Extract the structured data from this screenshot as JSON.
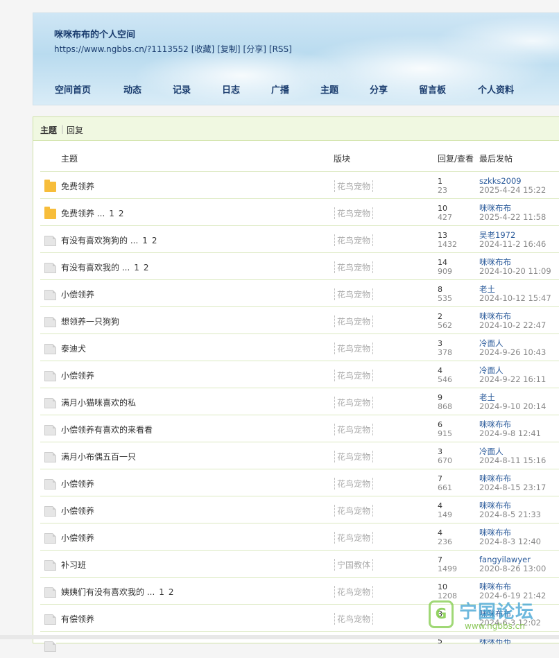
{
  "header": {
    "title": "咪咪布布的个人空间",
    "url": "https://www.ngbbs.cn/?1113552",
    "actions": [
      "[收藏]",
      "[复制]",
      "[分享]",
      "[RSS]"
    ],
    "nav": [
      "空间首页",
      "动态",
      "记录",
      "日志",
      "广播",
      "主题",
      "分享",
      "留言板",
      "个人资料"
    ]
  },
  "tabs": {
    "topic": "主题",
    "sep": "|",
    "reply": "回复"
  },
  "columns": {
    "topic": "主题",
    "forum": "版块",
    "stats": "回复/查看",
    "last": "最后发帖"
  },
  "rows": [
    {
      "icon": "folder-icon",
      "title": "免费领养",
      "pages": [],
      "forum": "花鸟宠物",
      "replies": "1",
      "views": "23",
      "user": "szkks2009",
      "time": "2025-4-24 15:22"
    },
    {
      "icon": "folder-icon",
      "title": "免费领养 ...",
      "pages": [
        "1",
        "2"
      ],
      "forum": "花鸟宠物",
      "replies": "10",
      "views": "427",
      "user": "咪咪布布",
      "time": "2025-4-22 11:58"
    },
    {
      "icon": "document-icon",
      "title": "有没有喜欢狗狗的 ...",
      "pages": [
        "1",
        "2"
      ],
      "forum": "花鸟宠物",
      "replies": "13",
      "views": "1432",
      "user": "吴老1972",
      "time": "2024-11-2 16:46"
    },
    {
      "icon": "document-icon",
      "title": "有没有喜欢我的 ...",
      "pages": [
        "1",
        "2"
      ],
      "forum": "花鸟宠物",
      "replies": "14",
      "views": "909",
      "user": "咪咪布布",
      "time": "2024-10-20 11:09"
    },
    {
      "icon": "document-icon",
      "title": "小偿领养",
      "pages": [],
      "forum": "花鸟宠物",
      "replies": "8",
      "views": "535",
      "user": "老土",
      "time": "2024-10-12 15:47"
    },
    {
      "icon": "document-icon",
      "title": "想领养一只狗狗",
      "pages": [],
      "forum": "花鸟宠物",
      "replies": "2",
      "views": "562",
      "user": "咪咪布布",
      "time": "2024-10-2 22:47"
    },
    {
      "icon": "document-icon",
      "title": "泰迪犬",
      "pages": [],
      "forum": "花鸟宠物",
      "replies": "3",
      "views": "378",
      "user": "冷面人",
      "time": "2024-9-26 10:43"
    },
    {
      "icon": "document-icon",
      "title": "小偿领养",
      "pages": [],
      "forum": "花鸟宠物",
      "replies": "4",
      "views": "546",
      "user": "冷面人",
      "time": "2024-9-22 16:11"
    },
    {
      "icon": "document-icon",
      "title": "满月小猫咪喜欢的私",
      "pages": [],
      "forum": "花鸟宠物",
      "replies": "9",
      "views": "868",
      "user": "老土",
      "time": "2024-9-10 20:14"
    },
    {
      "icon": "document-icon",
      "title": "小偿领养有喜欢的来看看",
      "pages": [],
      "forum": "花鸟宠物",
      "replies": "6",
      "views": "915",
      "user": "咪咪布布",
      "time": "2024-9-8 12:41"
    },
    {
      "icon": "document-icon",
      "title": "满月小布偶五百一只",
      "pages": [],
      "forum": "花鸟宠物",
      "replies": "3",
      "views": "670",
      "user": "冷面人",
      "time": "2024-8-11 15:16"
    },
    {
      "icon": "document-icon",
      "title": "小偿领养",
      "pages": [],
      "forum": "花鸟宠物",
      "replies": "7",
      "views": "661",
      "user": "咪咪布布",
      "time": "2024-8-15 23:17"
    },
    {
      "icon": "document-icon",
      "title": "小偿领养",
      "pages": [],
      "forum": "花鸟宠物",
      "replies": "4",
      "views": "149",
      "user": "咪咪布布",
      "time": "2024-8-5 21:33"
    },
    {
      "icon": "document-icon",
      "title": "小偿领养",
      "pages": [],
      "forum": "花鸟宠物",
      "replies": "4",
      "views": "236",
      "user": "咪咪布布",
      "time": "2024-8-3 12:40"
    },
    {
      "icon": "document-icon",
      "title": "补习班",
      "pages": [],
      "forum": "宁国教体",
      "replies": "7",
      "views": "1499",
      "user": "fangyilawyer",
      "time": "2020-8-26 13:00"
    },
    {
      "icon": "document-icon",
      "title": "姨姨们有没有喜欢我的 ...",
      "pages": [
        "1",
        "2"
      ],
      "forum": "花鸟宠物",
      "replies": "10",
      "views": "1208",
      "user": "咪咪布布",
      "time": "2024-6-19 21:42"
    },
    {
      "icon": "document-icon",
      "title": "有偿领养",
      "pages": [],
      "forum": "花鸟宠物",
      "replies": "3",
      "views": "",
      "user": "咪咪布布",
      "time": "2024-6-3 12:02"
    },
    {
      "icon": "document-icon",
      "title": "",
      "pages": [],
      "forum": "",
      "replies": "5",
      "views": "",
      "user": "咪咪布布",
      "time": ""
    }
  ],
  "watermark": {
    "name": "宁国论坛",
    "url": "www.ngbbs.cn"
  }
}
